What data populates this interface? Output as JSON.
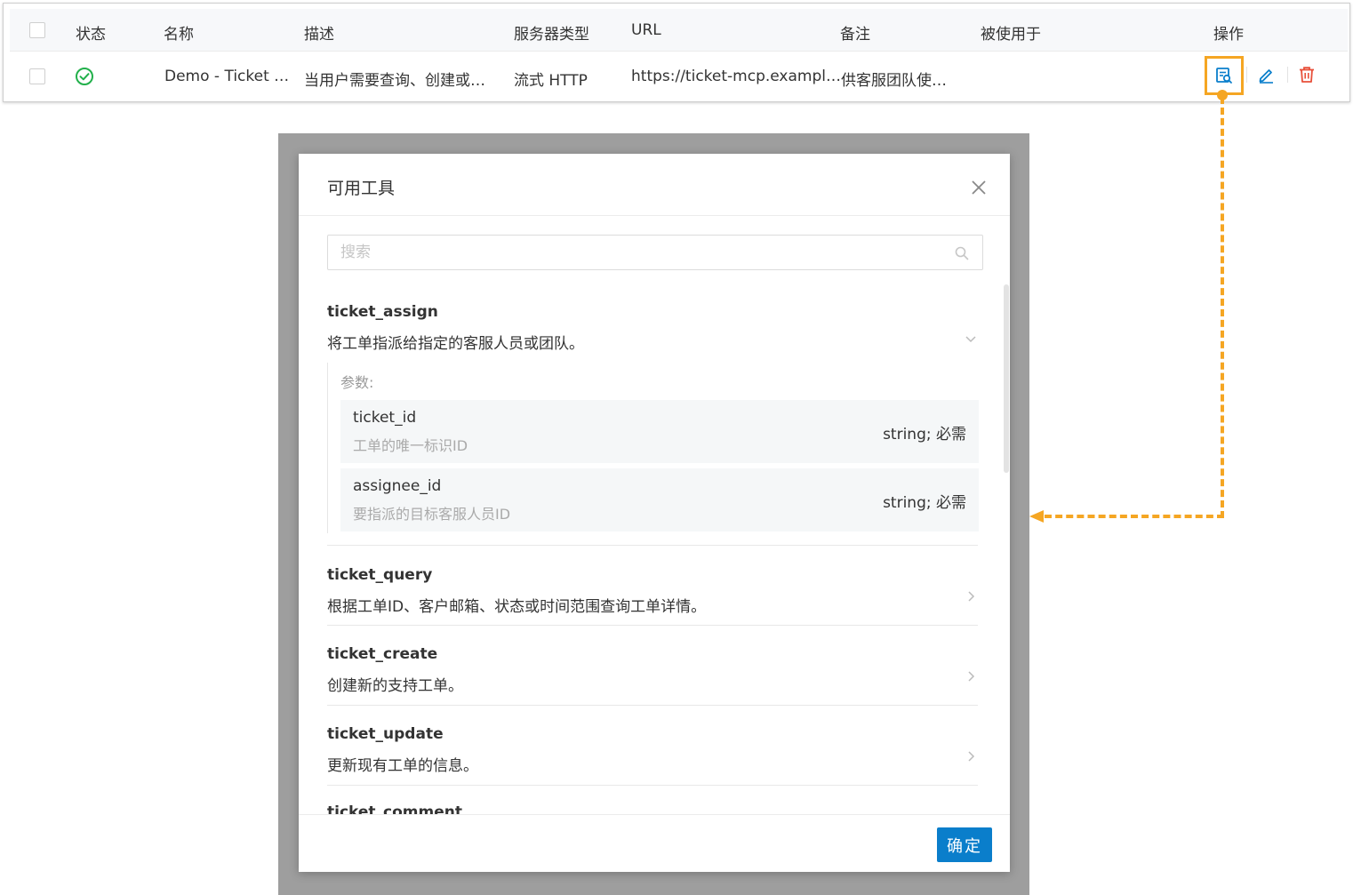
{
  "table": {
    "headers": {
      "status": "状态",
      "name": "名称",
      "description": "描述",
      "server_type": "服务器类型",
      "url": "URL",
      "remark": "备注",
      "used_by": "被使用于",
      "actions": "操作"
    },
    "row": {
      "status": "enabled",
      "name": "Demo - Ticket …",
      "description": "当用户需要查询、创建或…",
      "server_type": "流式 HTTP",
      "url": "https://ticket-mcp.exampl…",
      "remark": "供客服团队使…",
      "used_by": ""
    },
    "action_icons": [
      "view-tools-icon",
      "edit-icon",
      "delete-icon"
    ]
  },
  "colors": {
    "highlight": "#f5a623",
    "primary": "#0a7ecb",
    "success": "#22b04b",
    "danger": "#e8503a"
  },
  "modal": {
    "title": "可用工具",
    "search_placeholder": "搜索",
    "params_label": "参数:",
    "tools": [
      {
        "name": "ticket_assign",
        "description": "将工单指派给指定的客服人员或团队。",
        "expanded": true,
        "params": [
          {
            "name": "ticket_id",
            "description": "工单的唯一标识ID",
            "type": "string; 必需"
          },
          {
            "name": "assignee_id",
            "description": "要指派的目标客服人员ID",
            "type": "string; 必需"
          }
        ]
      },
      {
        "name": "ticket_query",
        "description": "根据工单ID、客户邮箱、状态或时间范围查询工单详情。",
        "expanded": false
      },
      {
        "name": "ticket_create",
        "description": "创建新的支持工单。",
        "expanded": false
      },
      {
        "name": "ticket_update",
        "description": "更新现有工单的信息。",
        "expanded": false
      },
      {
        "name": "ticket_comment",
        "description": "",
        "expanded": false
      }
    ],
    "confirm_label": "确定"
  }
}
